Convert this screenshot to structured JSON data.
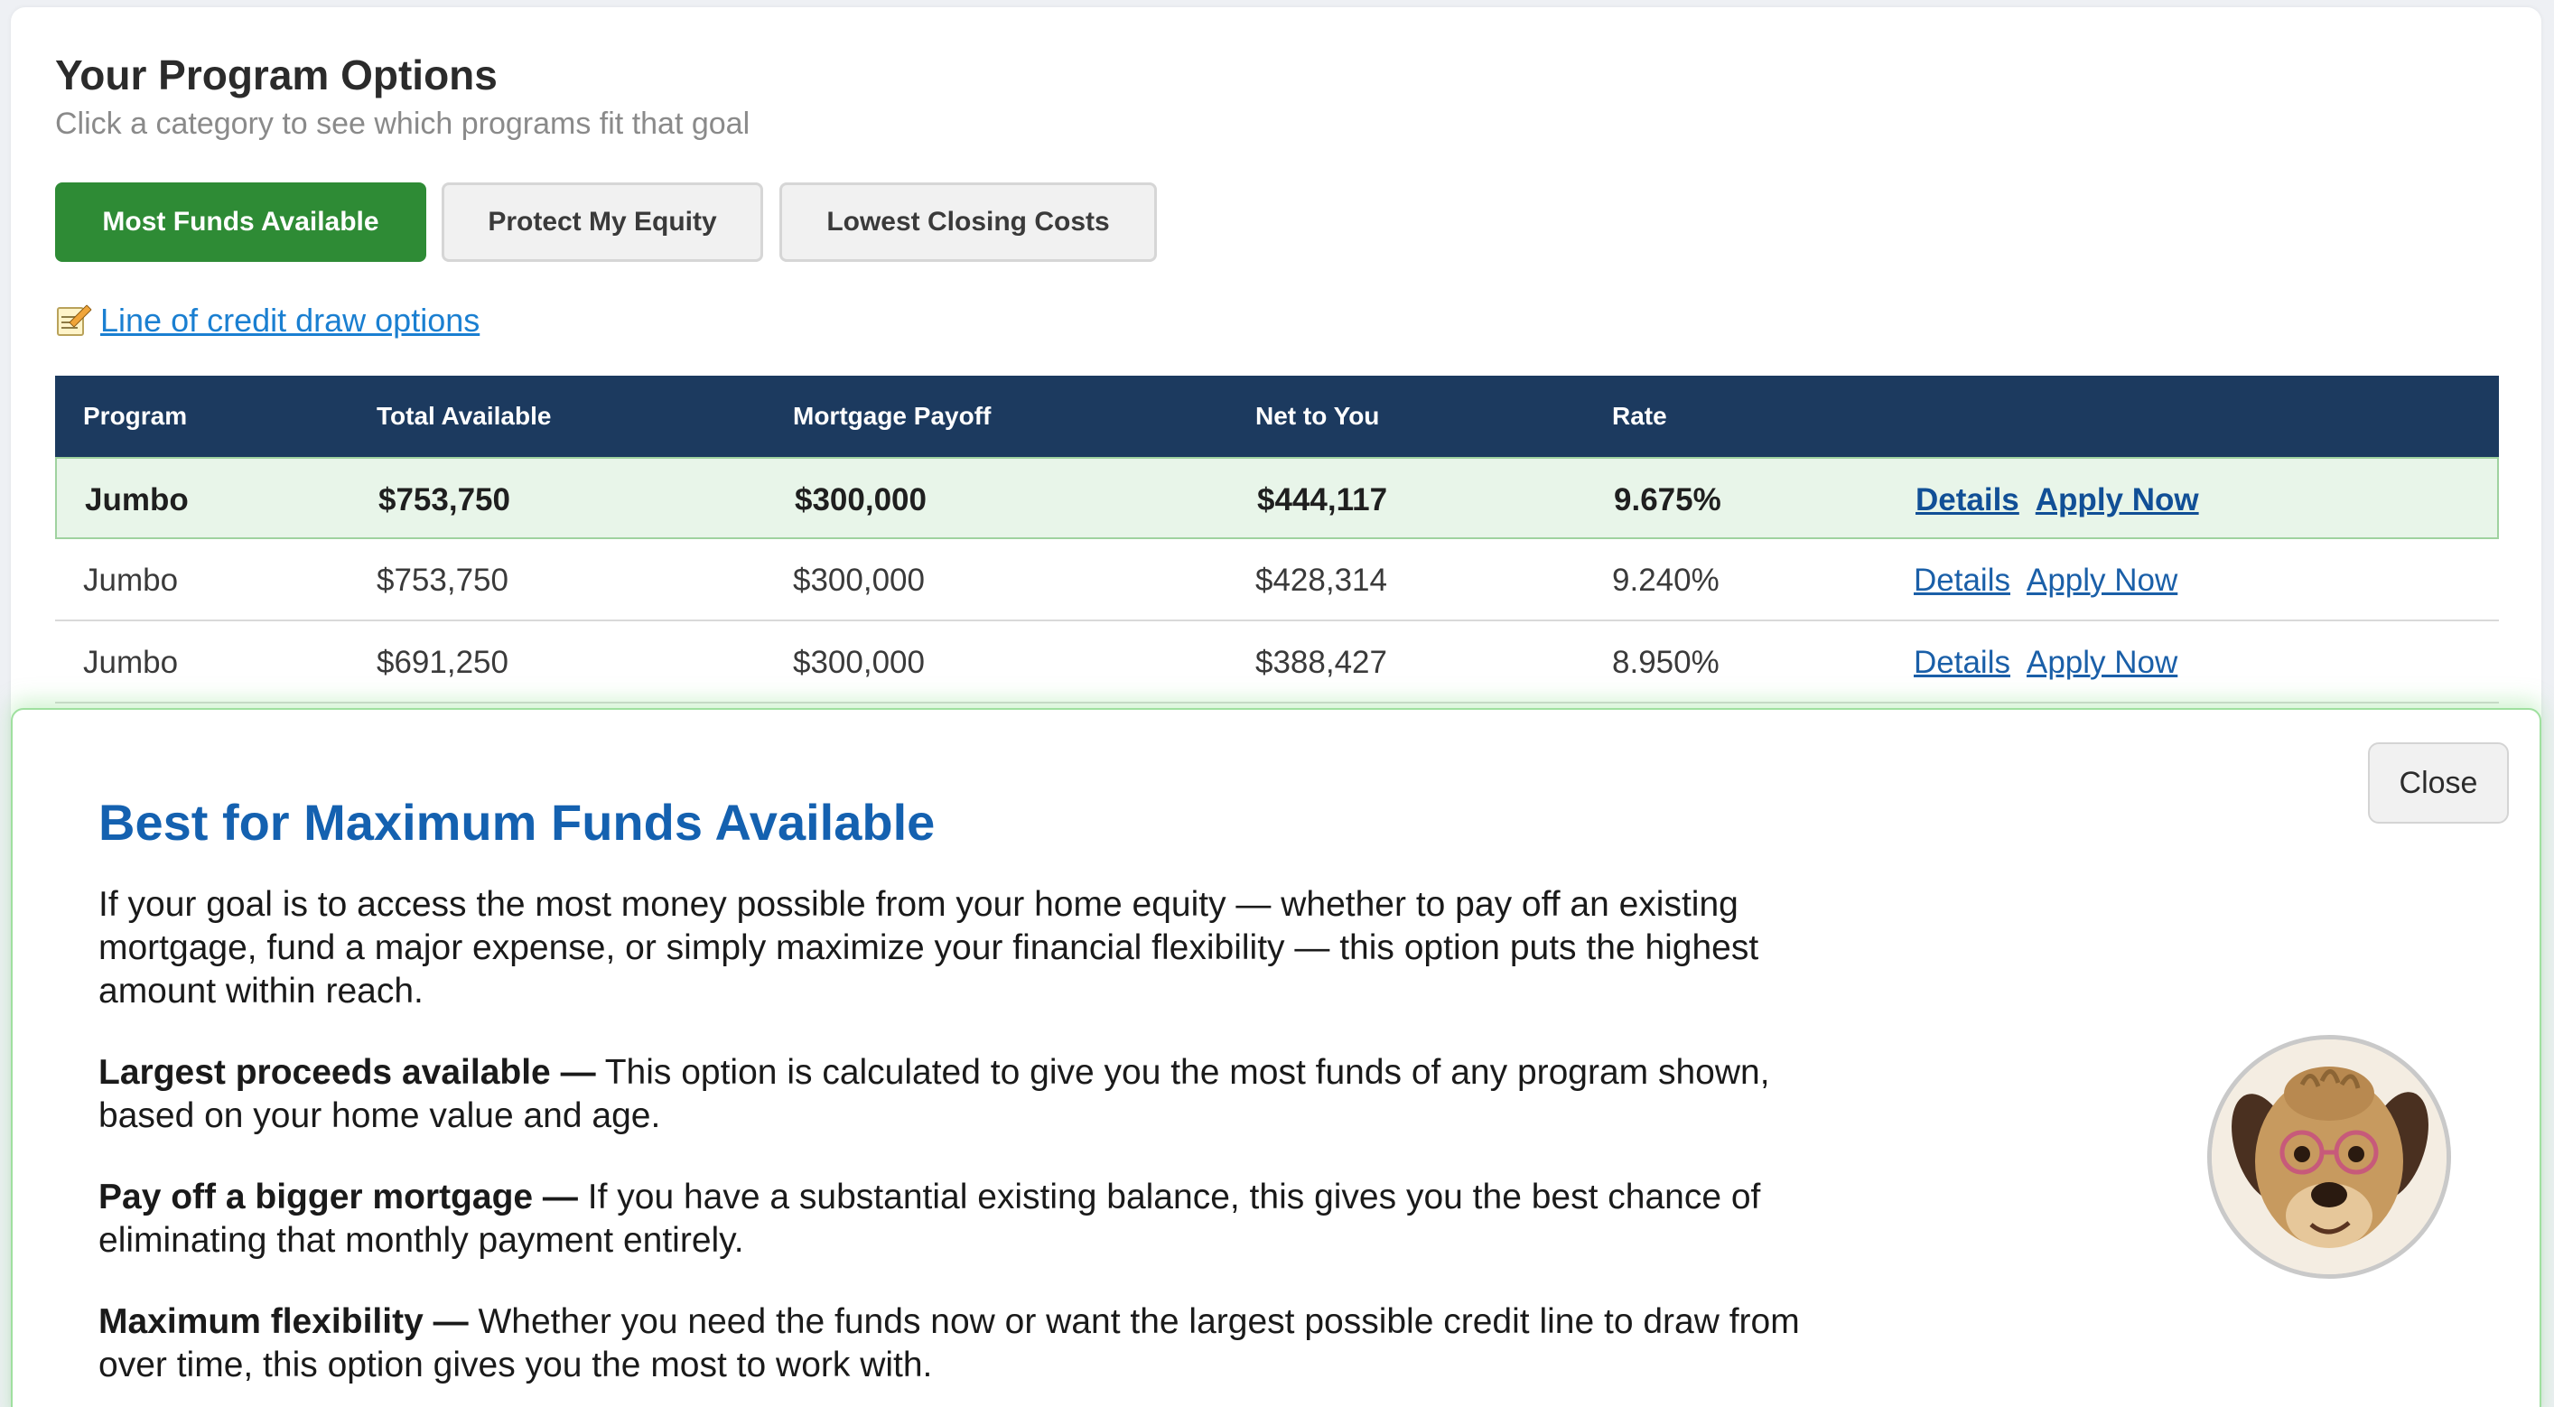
{
  "header": {
    "title": "Your Program Options",
    "subtitle": "Click a category to see which programs fit that goal"
  },
  "categories": [
    {
      "label": "Most Funds Available",
      "active": true
    },
    {
      "label": "Protect My Equity",
      "active": false
    },
    {
      "label": "Lowest Closing Costs",
      "active": false
    }
  ],
  "credit_link": {
    "icon": "memo-pencil-icon",
    "label": "Line of credit draw options"
  },
  "table": {
    "columns": [
      "Program",
      "Total Available",
      "Mortgage Payoff",
      "Net to You",
      "Rate",
      ""
    ],
    "rows": [
      {
        "program": "Jumbo",
        "total": "$753,750",
        "payoff": "$300,000",
        "net": "$444,117",
        "rate": "9.675%",
        "details": "Details",
        "apply": "Apply Now"
      },
      {
        "program": "Jumbo",
        "total": "$753,750",
        "payoff": "$300,000",
        "net": "$428,314",
        "rate": "9.240%",
        "details": "Details",
        "apply": "Apply Now"
      },
      {
        "program": "Jumbo",
        "total": "$691,250",
        "payoff": "$300,000",
        "net": "$388,427",
        "rate": "8.950%",
        "details": "Details",
        "apply": "Apply Now"
      }
    ]
  },
  "panel": {
    "close_label": "Close",
    "title": "Best for Maximum Funds Available",
    "intro": "If your goal is to access the most money possible from your home equity — whether to pay off an existing mortgage, fund a major expense, or simply maximize your financial flexibility — this option puts the highest amount within reach.",
    "points": [
      {
        "heading": "Largest proceeds available —",
        "text": " This option is calculated to give you the most funds of any program shown, based on your home value and age."
      },
      {
        "heading": "Pay off a bigger mortgage —",
        "text": " If you have a substantial existing balance, this gives you the best chance of eliminating that monthly payment entirely."
      },
      {
        "heading": "Maximum flexibility —",
        "text": " Whether you need the funds now or want the largest possible credit line to draw from over time, this option gives you the most to work with."
      }
    ],
    "mascot": "dog-mascot-avatar"
  },
  "colors": {
    "active_green": "#2e8b35",
    "table_header_navy": "#1c3a5f",
    "panel_title_blue": "#1461b0",
    "link_blue": "#1a7fd1"
  }
}
